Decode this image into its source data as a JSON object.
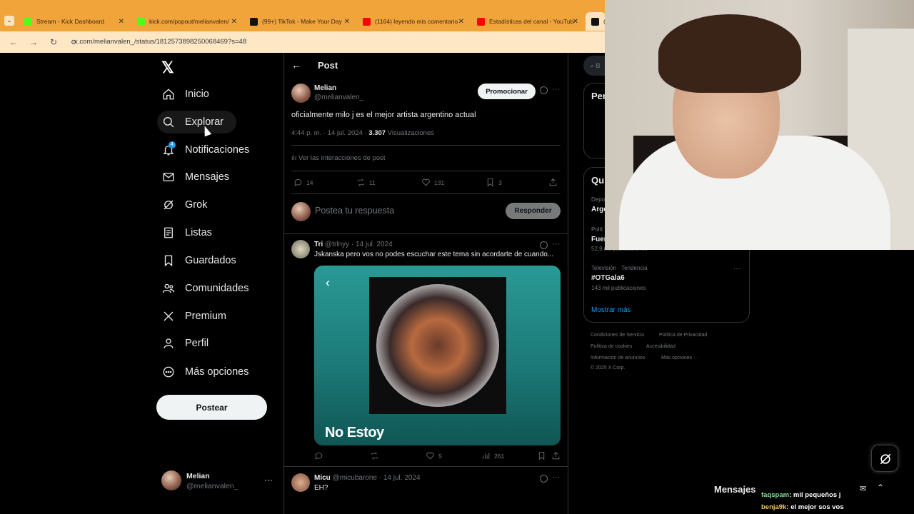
{
  "browser": {
    "tabs": [
      {
        "title": "Stream - Kick Dashboard",
        "color": "#53fc18"
      },
      {
        "title": "kick.com/popout/melianvalen/",
        "color": "#53fc18"
      },
      {
        "title": "(99+) TikTok - Make Your Day",
        "color": "#111111"
      },
      {
        "title": "(1164) leyendo mis comentario",
        "color": "#ff0000"
      },
      {
        "title": "Estadísticas del canal - YouTub",
        "color": "#ff0000"
      },
      {
        "title": "(4",
        "color": "#111111"
      }
    ],
    "url": "x.com/melianvalen_/status/1812573898250068469?s=48"
  },
  "sidebar": {
    "items": [
      {
        "label": "Inicio",
        "icon": "home-icon"
      },
      {
        "label": "Explorar",
        "icon": "search-icon"
      },
      {
        "label": "Notificaciones",
        "icon": "bell-icon",
        "badge": "4"
      },
      {
        "label": "Mensajes",
        "icon": "mail-icon"
      },
      {
        "label": "Grok",
        "icon": "grok-icon"
      },
      {
        "label": "Listas",
        "icon": "list-icon"
      },
      {
        "label": "Guardados",
        "icon": "bookmark-icon"
      },
      {
        "label": "Comunidades",
        "icon": "people-icon"
      },
      {
        "label": "Premium",
        "icon": "x-icon"
      },
      {
        "label": "Perfil",
        "icon": "person-icon"
      },
      {
        "label": "Más opciones",
        "icon": "more-circle-icon"
      }
    ],
    "post_button": "Postear",
    "account": {
      "name": "Melian",
      "handle": "@melianvalen_"
    }
  },
  "post": {
    "header": "Post",
    "author": "Melian",
    "handle": "@melianvalen_",
    "promote_label": "Promocionar",
    "text": "oficialmente milo j es el mejor artista argentino actual",
    "time": "4:44 p. m. · 14 jul. 2024 ·",
    "views": "3.307",
    "views_label": "Visualizaciones",
    "interactions_link": "Ver las interacciones de post",
    "stats": {
      "replies": "14",
      "reposts": "11",
      "likes": "131",
      "bookmarks": "3"
    },
    "reply_placeholder": "Postea tu respuesta",
    "reply_button": "Responder"
  },
  "replies": [
    {
      "author": "Tri",
      "handle": "@trlnyy · 14 jul. 2024",
      "text": "Jskanska pero vos no podes escuchar este tema sin acordarte de cuando...",
      "media_title": "No Estoy",
      "stats": {
        "likes": "5",
        "views": "261"
      }
    },
    {
      "author": "Micu",
      "handle": "@micubarone · 14 jul. 2024",
      "text": "EH?"
    }
  ],
  "right": {
    "search_placeholder": "B",
    "card1_title": "Per",
    "card2_title": "Qu",
    "trends": [
      {
        "meta": "Depo",
        "name": "Arge"
      },
      {
        "meta": "Polít",
        "name": "Fuer",
        "count": "52,9 mil publicaciones"
      },
      {
        "meta": "Televisión · Tendencia",
        "name": "#OTGala6",
        "count": "143 mil publicaciones"
      }
    ],
    "show_more": "Mostrar más",
    "footer": [
      "Condiciones de Servicio",
      "Política de Privacidad",
      "Política de cookies",
      "Accesibilidad",
      "Información de anuncios",
      "Más opciones ···",
      "© 2025 X Corp."
    ]
  },
  "messages": {
    "title": "Mensajes"
  },
  "chat": [
    {
      "user": "faqspam",
      "text": ": mil pequeños j",
      "color": "#7fe0a0"
    },
    {
      "user": "benja9k",
      "text": ": el mejor sos vos",
      "color": "#f0c070"
    }
  ]
}
